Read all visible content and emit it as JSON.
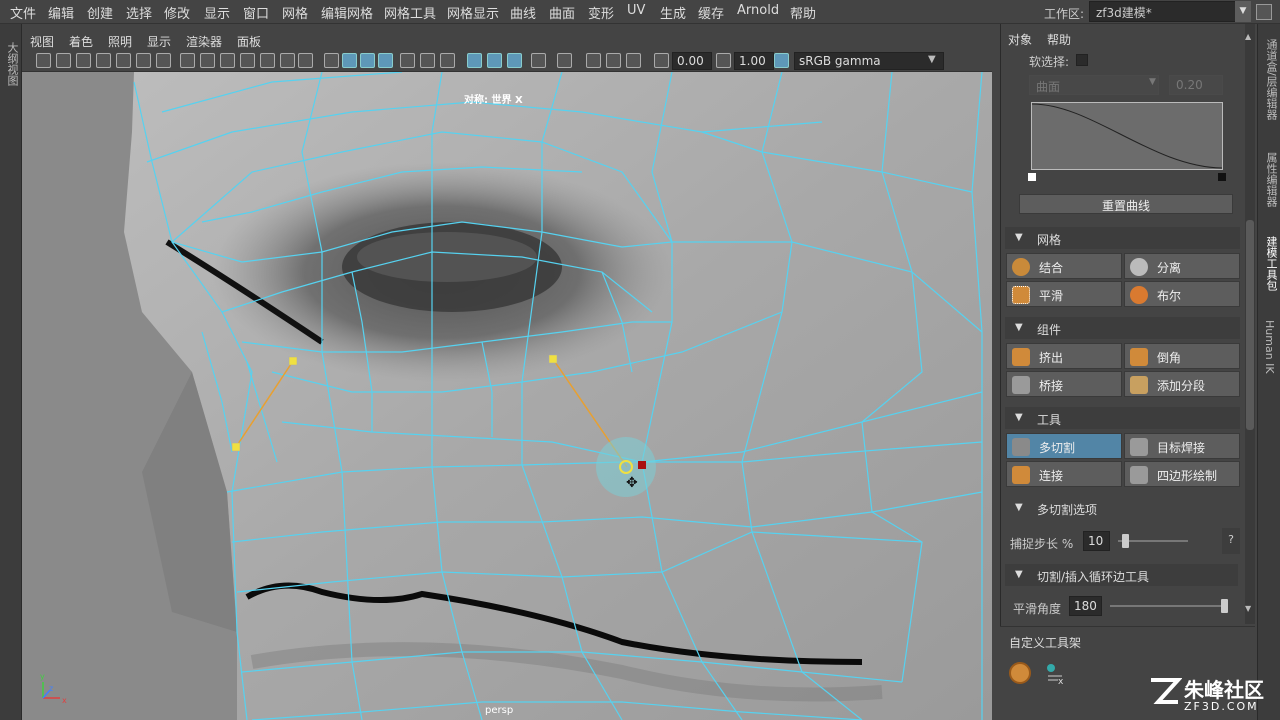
{
  "menubar": {
    "items": [
      "文件",
      "编辑",
      "创建",
      "选择",
      "修改",
      "显示",
      "窗口",
      "网格",
      "编辑网格",
      "网格工具",
      "网格显示",
      "曲线",
      "曲面",
      "变形",
      "UV",
      "生成",
      "缓存",
      "Arnold",
      "帮助"
    ],
    "workspace_label": "工作区:",
    "workspace_value": "zf3d建模*"
  },
  "left_strip": {
    "label": "大纲视图"
  },
  "panel_menu": {
    "items": [
      "视图",
      "着色",
      "照明",
      "显示",
      "渲染器",
      "面板"
    ]
  },
  "toolbar": {
    "exposure": "0.00",
    "gamma": "1.00",
    "color_space": "sRGB gamma"
  },
  "viewport": {
    "symmetry_label": "对称: 世界 X",
    "camera_label": "persp",
    "axis": {
      "x": "x",
      "y": "y",
      "z": "z"
    }
  },
  "right_panel": {
    "menu": [
      "对象",
      "帮助"
    ],
    "soft_select_label": "软选择:",
    "falloff_mode": "曲面",
    "falloff_value": "0.20",
    "reset_curve": "重置曲线",
    "sections": {
      "mesh": {
        "title": "网格",
        "buttons": [
          "结合",
          "分离",
          "平滑",
          "布尔"
        ]
      },
      "components": {
        "title": "组件",
        "buttons": [
          "挤出",
          "倒角",
          "桥接",
          "添加分段"
        ]
      },
      "tools": {
        "title": "工具",
        "buttons": [
          "多切割",
          "目标焊接",
          "连接",
          "四边形绘制"
        ]
      },
      "multicut_options": {
        "title": "多切割选项",
        "snap_label": "捕捉步长 %",
        "snap_value": "10",
        "snap_fraction": 0.1,
        "help": "?"
      },
      "loop_tool": {
        "title": "切割/插入循环边工具",
        "smooth_label": "平滑角度",
        "smooth_value": "180",
        "smooth_fraction": 1.0
      },
      "custom_shelf": {
        "title": "自定义工具架"
      }
    }
  },
  "right_strip": {
    "tabs": [
      "通道盒/层编辑器",
      "属性编辑器",
      "建模工具包",
      "Human IK"
    ]
  },
  "watermark": {
    "cn": "朱峰社区",
    "domain": "ZF3D.COM"
  },
  "colors": {
    "wire": "#56d2f0",
    "selection": "#f0e040",
    "accent": "#5285a6",
    "panel_bg": "#444444"
  }
}
